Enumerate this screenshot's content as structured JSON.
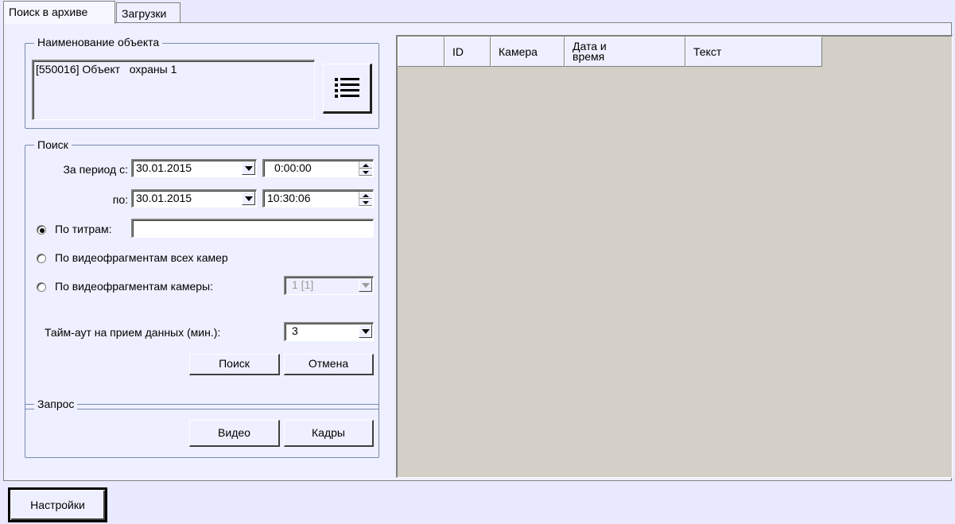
{
  "tabs": [
    {
      "label": "Поиск в архиве",
      "active": true
    },
    {
      "label": "Загрузки",
      "active": false
    }
  ],
  "object_group": {
    "legend": "Наименование объекта",
    "value": "[550016] Объект   охраны 1",
    "list_button_icon": "list-icon"
  },
  "search_group": {
    "legend": "Поиск",
    "period_from_label": "За период с:",
    "period_to_label": "по:",
    "from_date": "30.01.2015",
    "from_time": "0:00:00",
    "to_date": "30.01.2015",
    "to_time": "10:30:06",
    "by_captions_label": "По титрам:",
    "by_captions_value": "",
    "by_all_cameras_label": "По видеофрагментам всех камер",
    "by_camera_label": "По видеофрагментам камеры:",
    "camera_value": "1 [1]",
    "selected_option": "by_captions",
    "timeout_label": "Тайм-аут на прием данных (мин.):",
    "timeout_value": "3",
    "search_button": "Поиск",
    "cancel_button": "Отмена"
  },
  "request_group": {
    "legend": "Запрос",
    "video_button": "Видео",
    "frames_button": "Кадры"
  },
  "results_table": {
    "columns": [
      "",
      "ID",
      "Камера",
      "Дата и время",
      "Текст"
    ],
    "rows": []
  },
  "footer": {
    "settings_button": "Настройки"
  },
  "colors": {
    "background": "#e9eaff",
    "panel": "#eef0ff",
    "grid_background": "#d4d0c8"
  }
}
